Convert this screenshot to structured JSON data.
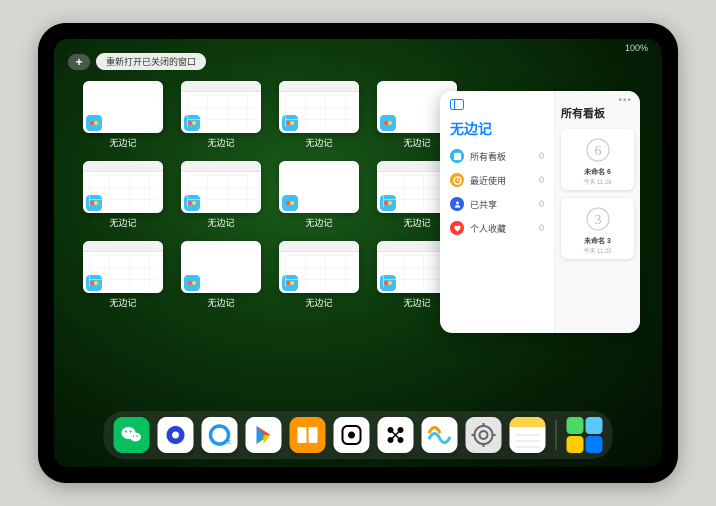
{
  "status": {
    "text": "100%"
  },
  "top": {
    "plus": "+",
    "reopen": "重新打开已关闭的窗口"
  },
  "app_label": "无边记",
  "thumbs": [
    {
      "variant": "blank"
    },
    {
      "variant": "toolbar"
    },
    {
      "variant": "toolbar"
    },
    {
      "variant": "blank"
    },
    {
      "variant": "toolbar"
    },
    {
      "variant": "toolbar"
    },
    {
      "variant": "blank"
    },
    {
      "variant": "toolbar"
    },
    {
      "variant": "toolbar"
    },
    {
      "variant": "blank"
    },
    {
      "variant": "toolbar"
    },
    {
      "variant": "toolbar"
    }
  ],
  "panel": {
    "title": "无边记",
    "items": [
      {
        "label": "所有看板",
        "count": "0",
        "color": "#2fb6e8"
      },
      {
        "label": "最近使用",
        "count": "0",
        "color": "#f5a623"
      },
      {
        "label": "已共享",
        "count": "0",
        "color": "#2f62e8"
      },
      {
        "label": "个人收藏",
        "count": "0",
        "color": "#ff3b30"
      }
    ],
    "right_title": "所有看板",
    "boards": [
      {
        "glyph": "6",
        "name": "未命名 6",
        "date": "今天 11:28"
      },
      {
        "glyph": "3",
        "name": "未命名 3",
        "date": "今天 11:25"
      }
    ]
  },
  "dock": [
    {
      "name": "wechat",
      "bg": "#07c160"
    },
    {
      "name": "quark",
      "bg": "#ffffff"
    },
    {
      "name": "qqbrowser",
      "bg": "#ffffff"
    },
    {
      "name": "play",
      "bg": "#ffffff"
    },
    {
      "name": "books",
      "bg": "#ff9500"
    },
    {
      "name": "dice",
      "bg": "#ffffff"
    },
    {
      "name": "connect",
      "bg": "#ffffff"
    },
    {
      "name": "freeform",
      "bg": "#ffffff"
    },
    {
      "name": "settings",
      "bg": "#e5e5e5"
    },
    {
      "name": "notes",
      "bg": "#ffffff"
    }
  ]
}
